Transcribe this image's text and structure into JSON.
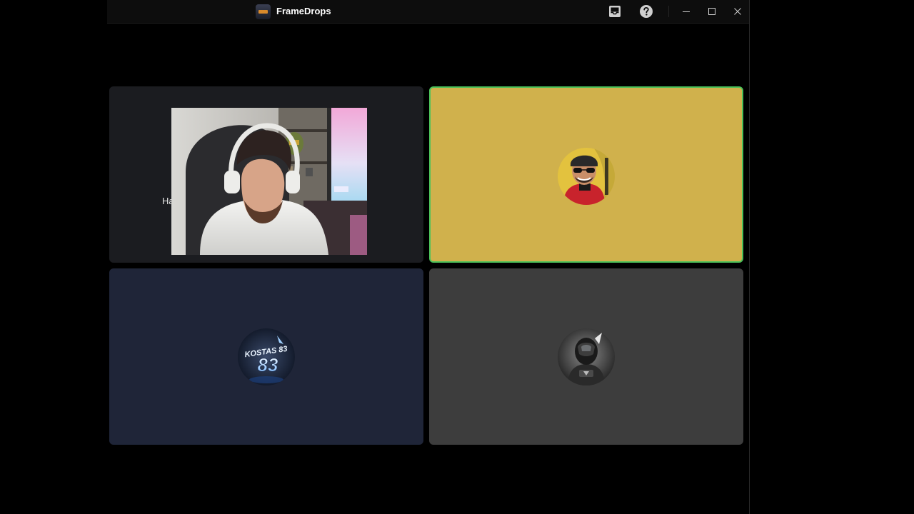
{
  "window": {
    "title": "FrameDrops",
    "icons": {
      "logo": "framedrops-logo-icon",
      "inbox": "inbox-icon",
      "help": "help-icon",
      "minimize": "minimize-icon",
      "maximize": "maximize-icon",
      "close": "close-icon"
    }
  },
  "participants": [
    {
      "name_partial": "Ha",
      "has_video": true,
      "tile_color": "#1b1c20"
    },
    {
      "has_video": false,
      "speaking": true,
      "tile_color": "#d0b14c",
      "border_color": "#4cc25a"
    },
    {
      "has_video": false,
      "avatar_text": "KOSTAS 83",
      "tile_color": "#1f2538"
    },
    {
      "has_video": false,
      "tile_color": "#3d3d3d"
    }
  ]
}
